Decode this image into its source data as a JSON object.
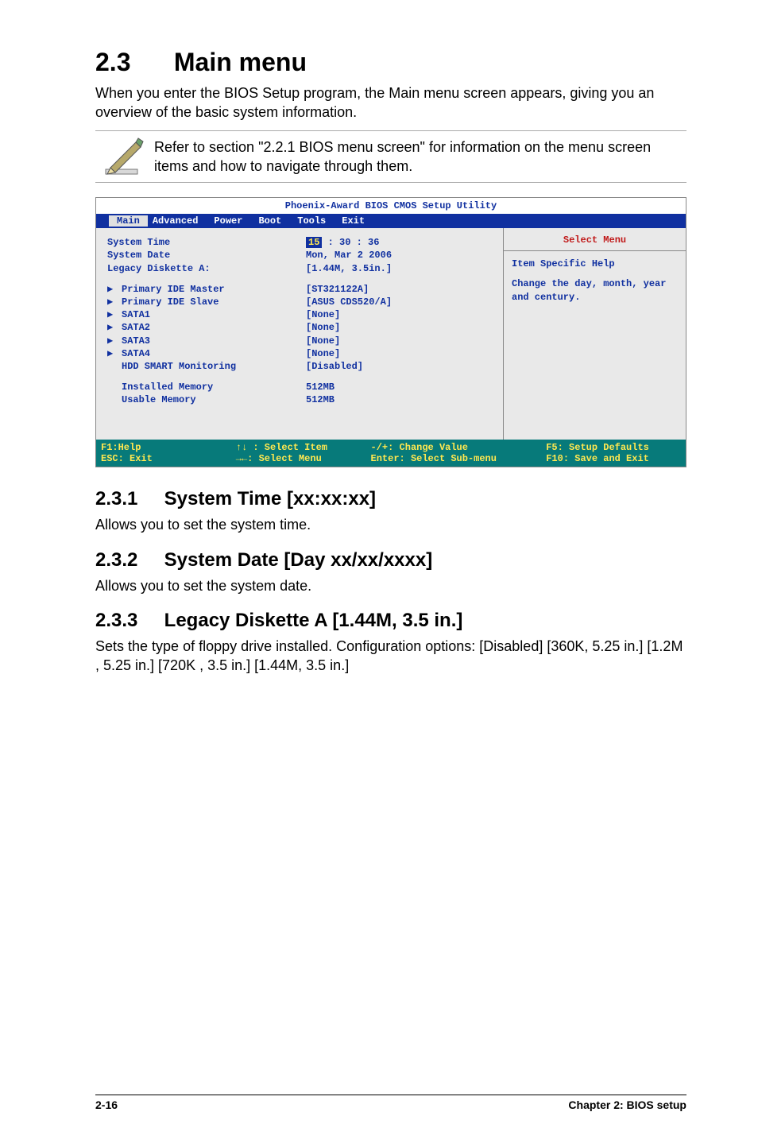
{
  "header": {
    "section_number": "2.3",
    "section_title": "Main menu",
    "lead": "When you enter the BIOS Setup program, the Main menu screen appears, giving you an overview of the basic system information.",
    "note": "Refer to section \"2.2.1  BIOS menu screen\" for information on the menu screen items and how to navigate through them."
  },
  "bios": {
    "title": "Phoenix-Award BIOS CMOS Setup Utility",
    "tabs": [
      "Main",
      "Advanced",
      "Power",
      "Boot",
      "Tools",
      "Exit"
    ],
    "active_tab": "Main",
    "rows": {
      "system_time_label": "System Time",
      "system_time_hour": "15",
      "system_time_rest": " : 30 : 36",
      "system_date_label": "System Date",
      "system_date_value": "Mon, Mar 2 2006",
      "legacy_label": "Legacy Diskette A:",
      "legacy_value": "[1.44M, 3.5in.]",
      "pim_label": "Primary IDE Master",
      "pim_value": "[ST321122A]",
      "pis_label": "Primary IDE Slave",
      "pis_value": "[ASUS CDS520/A]",
      "sata1_label": "SATA1",
      "sata1_value": "[None]",
      "sata2_label": "SATA2",
      "sata2_value": "[None]",
      "sata3_label": "SATA3",
      "sata3_value": "[None]",
      "sata4_label": "SATA4",
      "sata4_value": "[None]",
      "hdd_label": "HDD SMART Monitoring",
      "hdd_value": "[Disabled]",
      "installed_label": "Installed Memory",
      "installed_value": "512MB",
      "usable_label": "Usable Memory",
      "usable_value": "512MB"
    },
    "help": {
      "title": "Select Menu",
      "line1": "Item Specific Help",
      "line2": "Change the day, month, year and century."
    },
    "footer": {
      "c1a": "F1:Help",
      "c1b": "ESC: Exit",
      "c2a": "↑↓ : Select Item",
      "c2b": "→←: Select Menu",
      "c3a": "-/+: Change Value",
      "c3b": "Enter: Select Sub-menu",
      "c4a": "F5: Setup Defaults",
      "c4b": "F10: Save and Exit"
    }
  },
  "subsections": {
    "s1_num": "2.3.1",
    "s1_title": "System Time [xx:xx:xx]",
    "s1_body": "Allows you to set the system time.",
    "s2_num": "2.3.2",
    "s2_title": "System Date [Day xx/xx/xxxx]",
    "s2_body": "Allows you to set the system date.",
    "s3_num": "2.3.3",
    "s3_title": "Legacy Diskette A [1.44M, 3.5 in.]",
    "s3_body": "Sets the type of floppy drive installed. Configuration options: [Disabled] [360K, 5.25 in.] [1.2M , 5.25 in.] [720K , 3.5 in.] [1.44M, 3.5 in.]"
  },
  "footer": {
    "left": "2-16",
    "right": "Chapter 2: BIOS setup"
  }
}
